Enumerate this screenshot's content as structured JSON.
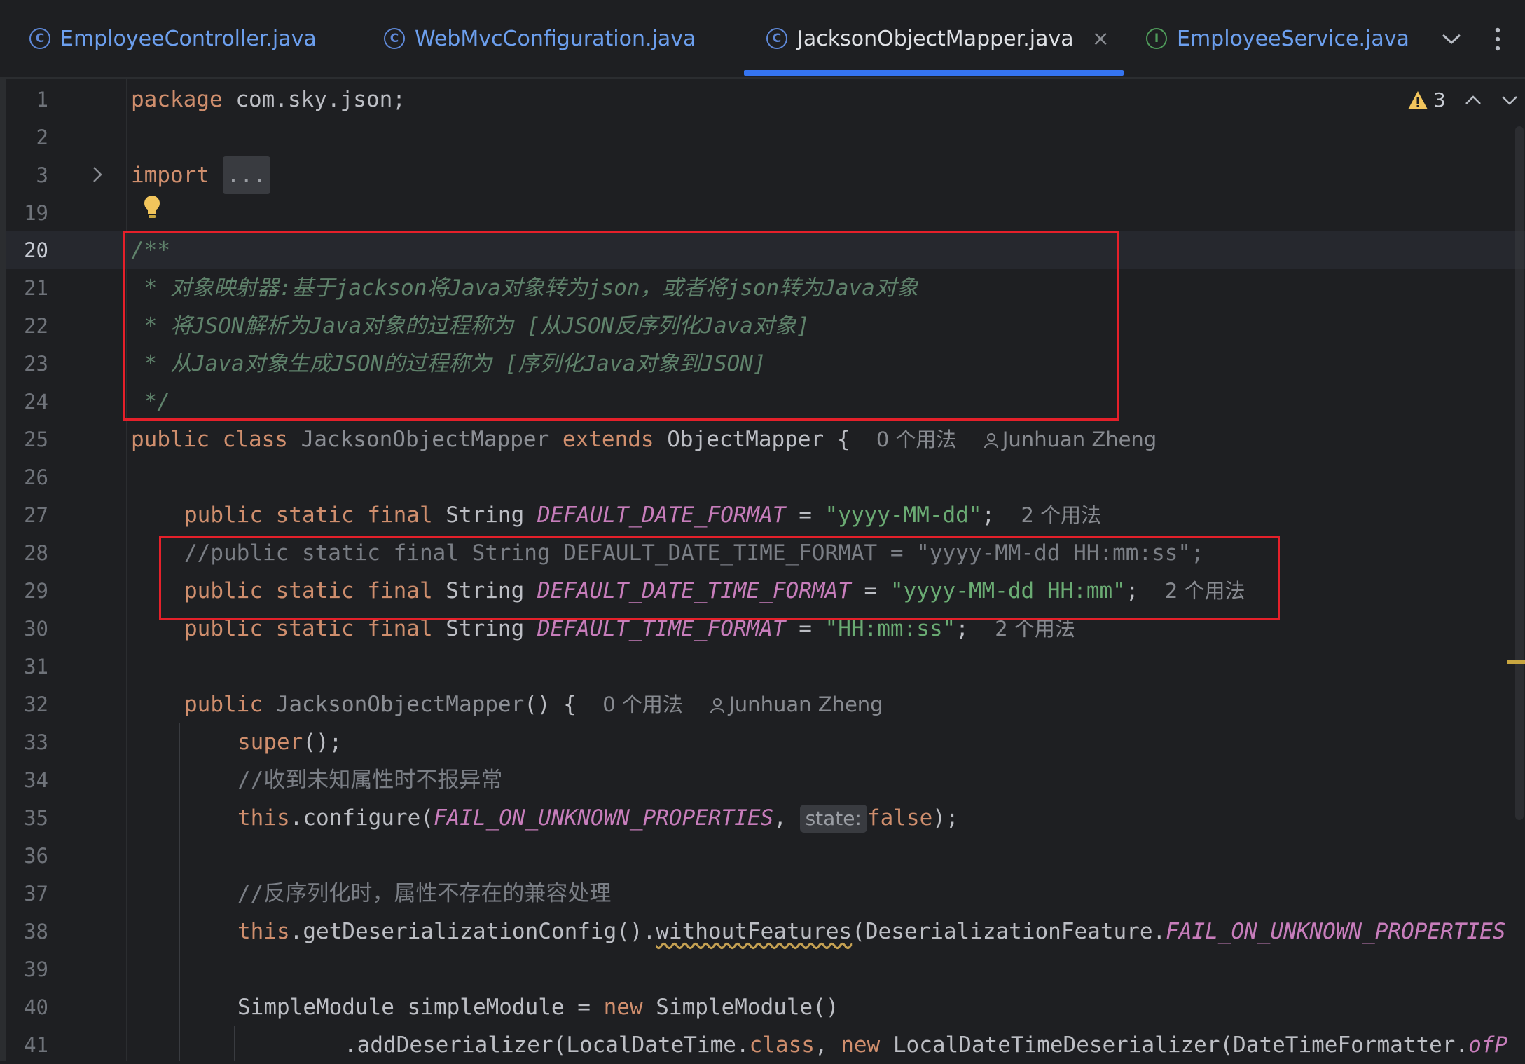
{
  "tabs": [
    {
      "label": "EmployeeController.java",
      "icon": "C",
      "kind": "class"
    },
    {
      "label": "WebMvcConfiguration.java",
      "icon": "C",
      "kind": "class"
    },
    {
      "label": "JacksonObjectMapper.java",
      "icon": "C",
      "kind": "class",
      "active": true
    },
    {
      "label": "EmployeeService.java",
      "icon": "I",
      "kind": "interface"
    }
  ],
  "tab_close": "×",
  "inspections": {
    "warning_count": "3"
  },
  "line_numbers": [
    "1",
    "2",
    "3",
    "19",
    "20",
    "21",
    "22",
    "23",
    "24",
    "25",
    "26",
    "27",
    "28",
    "29",
    "30",
    "31",
    "32",
    "33",
    "34",
    "35",
    "36",
    "37",
    "38",
    "39",
    "40",
    "41"
  ],
  "code": {
    "l1_kw": "package",
    "l1_rest": " com.sky.json;",
    "l3_kw": "import",
    "l3_fold": "...",
    "l20": "/**",
    "l21": " * 对象映射器:基于jackson将Java对象转为json，或者将json转为Java对象",
    "l22": " * 将JSON解析为Java对象的过程称为 [从JSON反序列化Java对象]",
    "l23": " * 从Java对象生成JSON的过程称为 [序列化Java对象到JSON]",
    "l24": " */",
    "l25_kw": "public class",
    "l25_name": "JacksonObjectMapper",
    "l25_ext": "extends",
    "l25_rest": " ObjectMapper {",
    "l25_hint": "0 个用法",
    "author": "Junhuan Zheng",
    "mod": "public static final",
    "type_string": "String",
    "l27_const": "DEFAULT_DATE_FORMAT",
    "l27_eq": " = ",
    "l27_val": "\"yyyy-MM-dd\"",
    "l27_end": ";",
    "hint_2": "2 个用法",
    "l28": "//public static final String DEFAULT_DATE_TIME_FORMAT = \"yyyy-MM-dd HH:mm:ss\";",
    "l29_const": "DEFAULT_DATE_TIME_FORMAT",
    "l29_val": "\"yyyy-MM-dd HH:mm\"",
    "l30_const": "DEFAULT_TIME_FORMAT",
    "l30_val": "\"HH:mm:ss\"",
    "l32_kw": "public",
    "l32_name": "JacksonObjectMapper",
    "l32_rest": "() {",
    "l32_hint": "0 个用法",
    "l33_kw": "super",
    "l33_rest": "();",
    "l34": "//收到未知属性时不报异常",
    "l35_this": "this",
    "l35_a": ".configure(",
    "l35_const": "FAIL_ON_UNKNOWN_PROPERTIES",
    "l35_b": ", ",
    "l35_param": "state:",
    "l35_false": "false",
    "l35_end": ");",
    "l37": "//反序列化时，属性不存在的兼容处理",
    "l38_this": "this",
    "l38_a": ".getDeserializationConfig().",
    "l38_method": "withoutFeatures",
    "l38_b": "(DeserializationFeature.",
    "l38_const": "FAIL_ON_UNKNOWN_PROPERTIES",
    "l40_a": "SimpleModule simpleModule = ",
    "l40_new": "new",
    "l40_b": " SimpleModule()",
    "l41_a": ".addDeserializer(LocalDateTime.",
    "l41_class": "class",
    "l41_b": ", ",
    "l41_new": "new",
    "l41_c": " LocalDateTimeDeserializer(DateTimeFormatter.",
    "l41_d": "ofP"
  },
  "colors": {
    "background": "#1e1f22",
    "keyword": "#cf8e6d",
    "string": "#6aab73",
    "constant": "#c77dbb",
    "highlight_box": "#e5202a",
    "active_tab_underline": "#3574f0"
  }
}
